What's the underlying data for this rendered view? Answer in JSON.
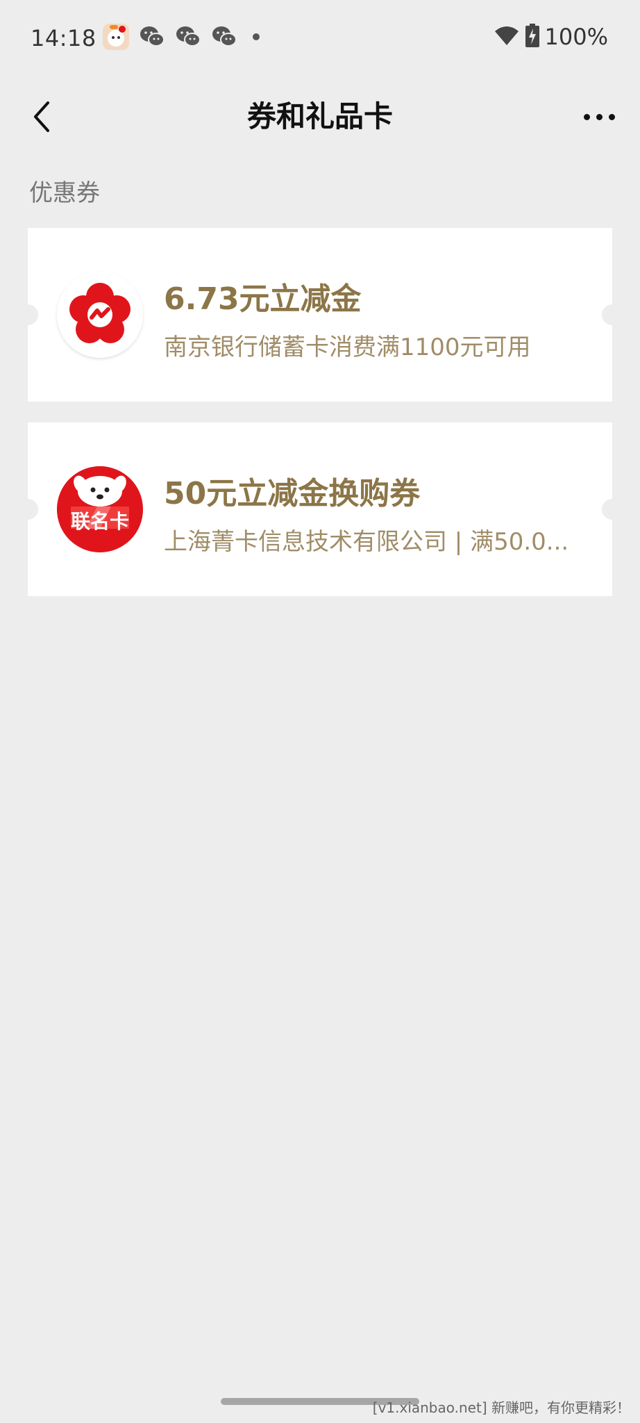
{
  "status_bar": {
    "time": "14:18",
    "battery": "100%",
    "icons": [
      "app-notification-icon",
      "wechat-icon",
      "wechat-icon",
      "wechat-icon",
      "more-notifications-dot",
      "wifi-icon",
      "battery-charging-icon"
    ]
  },
  "nav": {
    "title": "券和礼品卡",
    "back_icon": "chevron-left-icon",
    "more_icon": "more-dots-icon"
  },
  "section": {
    "label": "优惠券"
  },
  "coupons": [
    {
      "title": "6.73元立减金",
      "description": "南京银行储蓄卡消费满1100元可用",
      "logo": "nanjing-bank-logo",
      "logo_color": "#e0151b"
    },
    {
      "title": "50元立减金换购券",
      "description": "上海菁卡信息技术有限公司 | 满50.0...",
      "logo": "jd-co-branded-card-logo",
      "logo_text": "联名卡",
      "logo_color": "#e0151b"
    }
  ],
  "colors": {
    "background": "#ededed",
    "coupon_title": "#8c7547",
    "coupon_desc": "#a08c67"
  },
  "watermark": "[v1.xianbao.net] 新赚吧，有你更精彩！"
}
